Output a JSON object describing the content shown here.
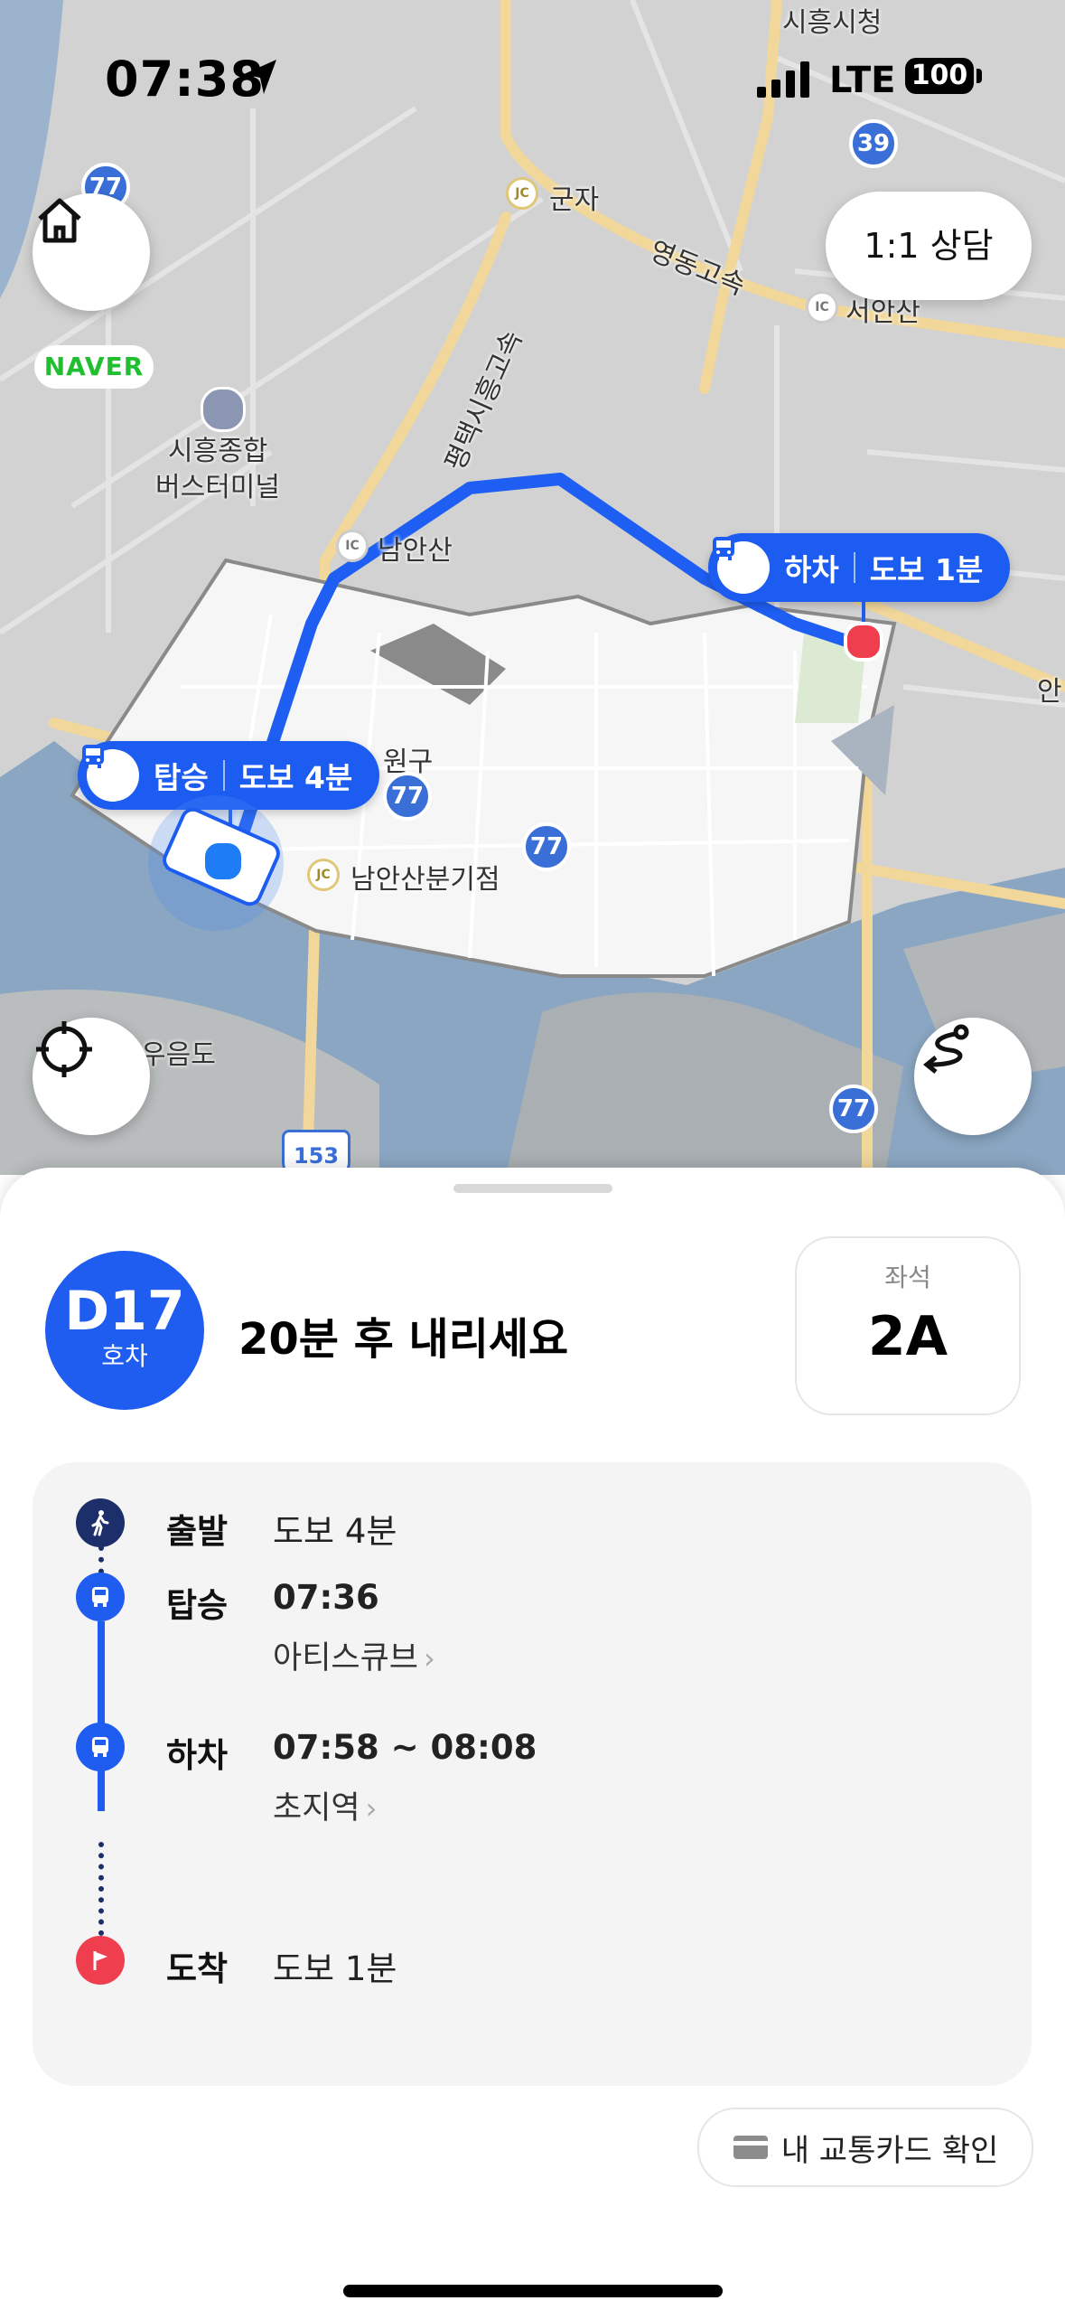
{
  "status_bar": {
    "time": "07:38",
    "network": "LTE",
    "battery": "100"
  },
  "map": {
    "naver_logo": "NAVER",
    "consult_button": "1:1 상담",
    "labels": {
      "siheung_city_hall": "시흥시청",
      "gunja": "군자",
      "yeongdong_expwy": "영동고속",
      "seoansan": "서안산",
      "pyeongtaek_siheung": "평택시흥고속",
      "bus_terminal_1": "시흥종합",
      "bus_terminal_2": "버스터미널",
      "namansan_ic": "남안산",
      "danwon": "원구",
      "namansan_jc": "남안산분기점",
      "ueumdo": "우음도",
      "an_edge": "안"
    },
    "route_badges": {
      "r77a": "77",
      "r77b": "77",
      "r77c": "77",
      "r77d": "77",
      "r39": "39",
      "r153": "153"
    },
    "interchange_marks": {
      "jc": "JC",
      "ic": "IC"
    },
    "board_pill": {
      "label": "탑승",
      "walk": "도보 4분"
    },
    "alight_pill": {
      "label": "하차",
      "walk": "도보 1분"
    }
  },
  "sheet": {
    "bus_number": "D17",
    "bus_sub": "호차",
    "headline": "20분 후 내리세요",
    "seat_label": "좌석",
    "seat_value": "2A",
    "steps": [
      {
        "label": "출발",
        "value": "도보 4분",
        "sub": ""
      },
      {
        "label": "탑승",
        "value": "07:36",
        "sub": "아티스큐브"
      },
      {
        "label": "하차",
        "value": "07:58 ~ 08:08",
        "sub": "초지역"
      },
      {
        "label": "도착",
        "value": "도보 1분",
        "sub": ""
      }
    ],
    "card_button": "내 교통카드 확인"
  },
  "colors": {
    "primary_blue": "#1f5cf0",
    "destination_red": "#ef3f4f",
    "walk_navy": "#1d2f6b"
  }
}
